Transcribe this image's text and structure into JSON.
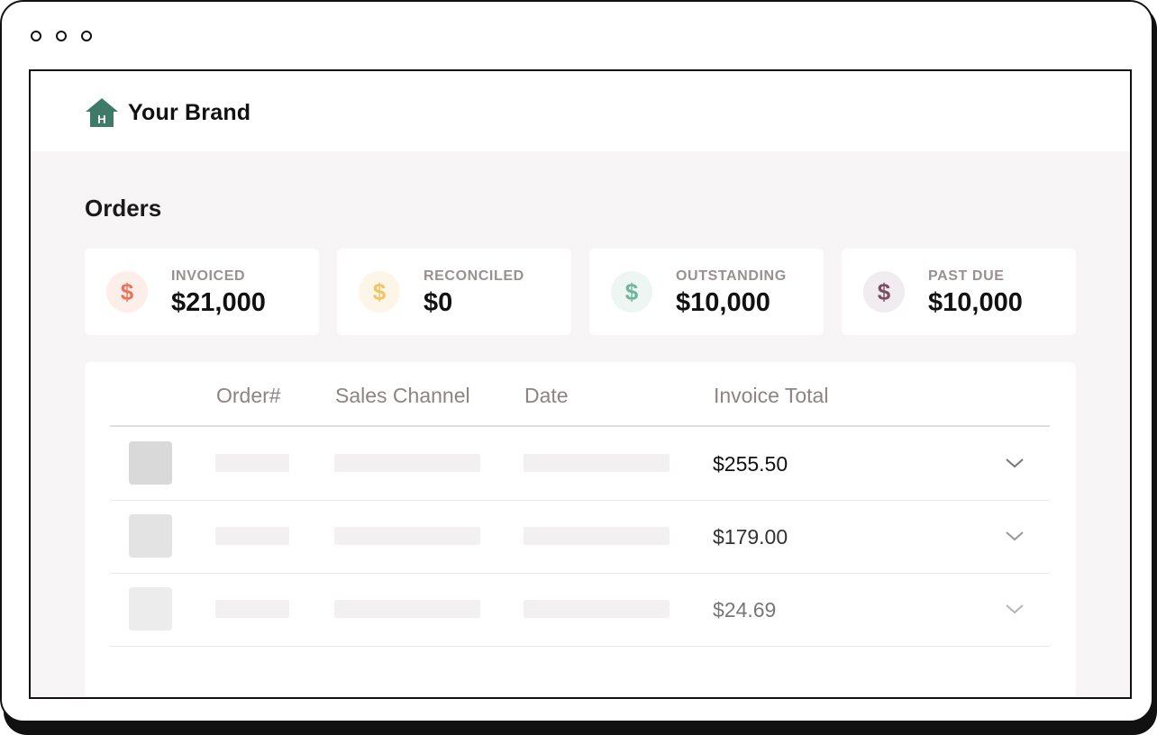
{
  "window": {
    "controls": [
      "dot",
      "dot",
      "dot"
    ]
  },
  "brand": {
    "name": "Your Brand",
    "logo_letter": "H",
    "logo_color": "#3f7a68"
  },
  "page": {
    "title": "Orders"
  },
  "stats": [
    {
      "label": "INVOICED",
      "value": "$21,000",
      "icon": "dollar-icon",
      "icon_color": "#e8745d",
      "icon_bg": "#fdeeea"
    },
    {
      "label": "RECONCILED",
      "value": "$0",
      "icon": "dollar-icon",
      "icon_color": "#f1c466",
      "icon_bg": "#fdf6e8"
    },
    {
      "label": "OUTSTANDING",
      "value": "$10,000",
      "icon": "dollar-icon",
      "icon_color": "#6fb59b",
      "icon_bg": "#edf6f2"
    },
    {
      "label": "PAST DUE",
      "value": "$10,000",
      "icon": "dollar-icon",
      "icon_color": "#7a4e66",
      "icon_bg": "#f1ecef"
    }
  ],
  "table": {
    "columns": [
      "Order#",
      "Sales Channel",
      "Date",
      "Invoice Total"
    ],
    "rows": [
      {
        "invoice_total": "$255.50"
      },
      {
        "invoice_total": "$179.00"
      },
      {
        "invoice_total": "$24.69"
      }
    ]
  }
}
